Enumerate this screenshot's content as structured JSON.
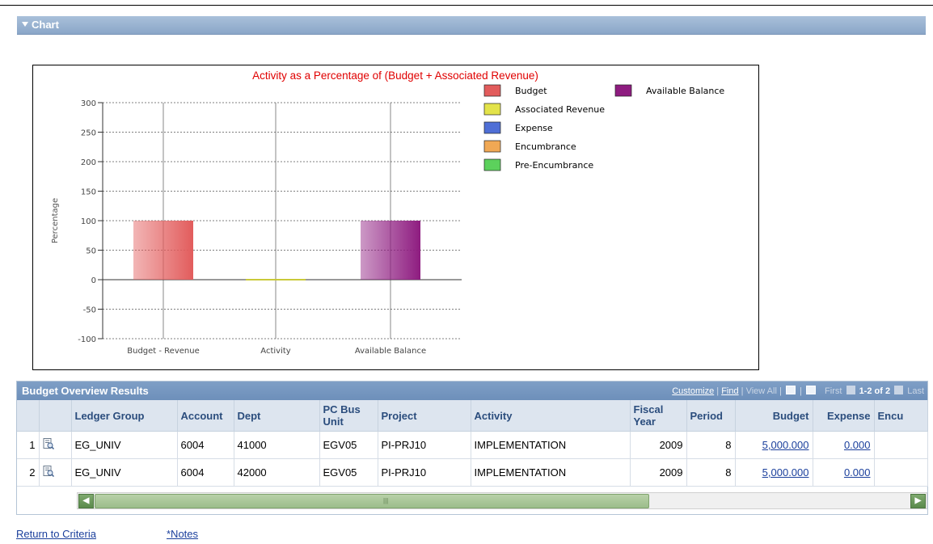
{
  "section": {
    "title": "Chart"
  },
  "chart_data": {
    "type": "bar",
    "title": "Activity as a Percentage of (Budget + Associated Revenue)",
    "ylabel": "Percentage",
    "xlabel": "",
    "ylim": [
      -100,
      300
    ],
    "yticks": [
      300,
      250,
      200,
      150,
      100,
      50,
      0,
      -50,
      -100
    ],
    "categories": [
      "Budget - Revenue",
      "Activity",
      "Available Balance"
    ],
    "series": [
      {
        "name": "Budget",
        "values": [
          100,
          0,
          0
        ],
        "color": "#e25c5c"
      },
      {
        "name": "Associated Revenue",
        "values": [
          0,
          0,
          0
        ],
        "color": "#e3e34a"
      },
      {
        "name": "Expense",
        "values": [
          0,
          0,
          0
        ],
        "color": "#4f6fd6"
      },
      {
        "name": "Encumbrance",
        "values": [
          0,
          0,
          0
        ],
        "color": "#f0a854"
      },
      {
        "name": "Pre-Encumbrance",
        "values": [
          0,
          0,
          0
        ],
        "color": "#5cd15c"
      },
      {
        "name": "Available Balance",
        "values": [
          0,
          0,
          100
        ],
        "color": "#8e1c80"
      }
    ],
    "grid": true,
    "legend": "right"
  },
  "grid": {
    "title": "Budget Overview Results",
    "nav": {
      "customize": "Customize",
      "find": "Find",
      "view_all": "View All",
      "first": "First",
      "range": "1-2 of 2",
      "last": "Last"
    },
    "columns": [
      "",
      "",
      "Ledger Group",
      "Account",
      "Dept",
      "PC Bus Unit",
      "Project",
      "Activity",
      "Fiscal Year",
      "Period",
      "Budget",
      "Expense",
      "Encu"
    ],
    "rows": [
      {
        "n": "1",
        "ledger_group": "EG_UNIV",
        "account": "6004",
        "dept": "41000",
        "pc_bus_unit": "EGV05",
        "project": "PI-PRJ10",
        "activity": "IMPLEMENTATION",
        "fiscal_year": "2009",
        "period": "8",
        "budget": "5,000.000",
        "expense": "0.000"
      },
      {
        "n": "2",
        "ledger_group": "EG_UNIV",
        "account": "6004",
        "dept": "42000",
        "pc_bus_unit": "EGV05",
        "project": "PI-PRJ10",
        "activity": "IMPLEMENTATION",
        "fiscal_year": "2009",
        "period": "8",
        "budget": "5,000.000",
        "expense": "0.000"
      }
    ]
  },
  "footer": {
    "return_to_criteria": "Return to Criteria",
    "notes": "*Notes"
  }
}
